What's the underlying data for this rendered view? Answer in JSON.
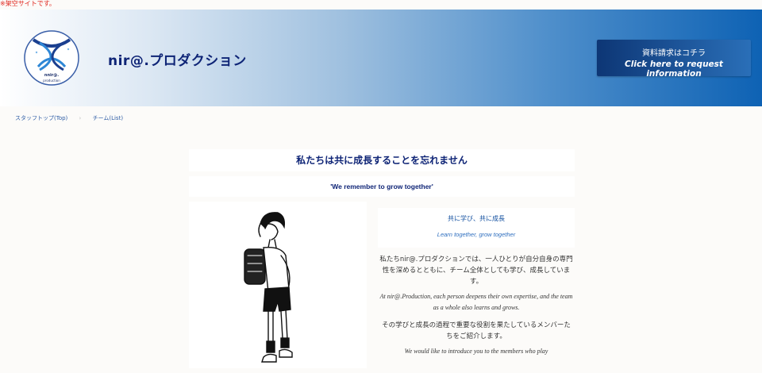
{
  "notice": "※架空サイトです。",
  "header": {
    "site_title": "nir@.プロダクション",
    "logo_text": "nnir@.",
    "logo_subtext": "production",
    "cta_jp": "資料請求はコチラ",
    "cta_en": "Click here to request information"
  },
  "breadcrumb": {
    "items": [
      "スタッフトップ(Top)",
      "チーム(List)"
    ],
    "separator": "›"
  },
  "content": {
    "heading": "私たちは共に成長することを忘れません",
    "subheading": "'We remember to grow together'",
    "card_title_jp": "共に学び、共に成長",
    "card_title_en": "Learn together, grow together",
    "body_jp_1": "私たちnir@.プロダクションでは、一人ひとりが自分自身の専門性を深めるとともに、チーム全体としても学び、成長しています。",
    "body_en_1": "At nir@.Production, each person deepens their own expertise, and the team as a whole also learns and grows.",
    "body_jp_2": "その学びと成長の過程で重要な役割を果たしているメンバーたちをご紹介します。",
    "body_en_2": "We would like to introduce you to the members who play"
  },
  "colors": {
    "title": "#0e2476",
    "accent_blue": "#0e62b4",
    "notice_red": "#e0241b"
  }
}
